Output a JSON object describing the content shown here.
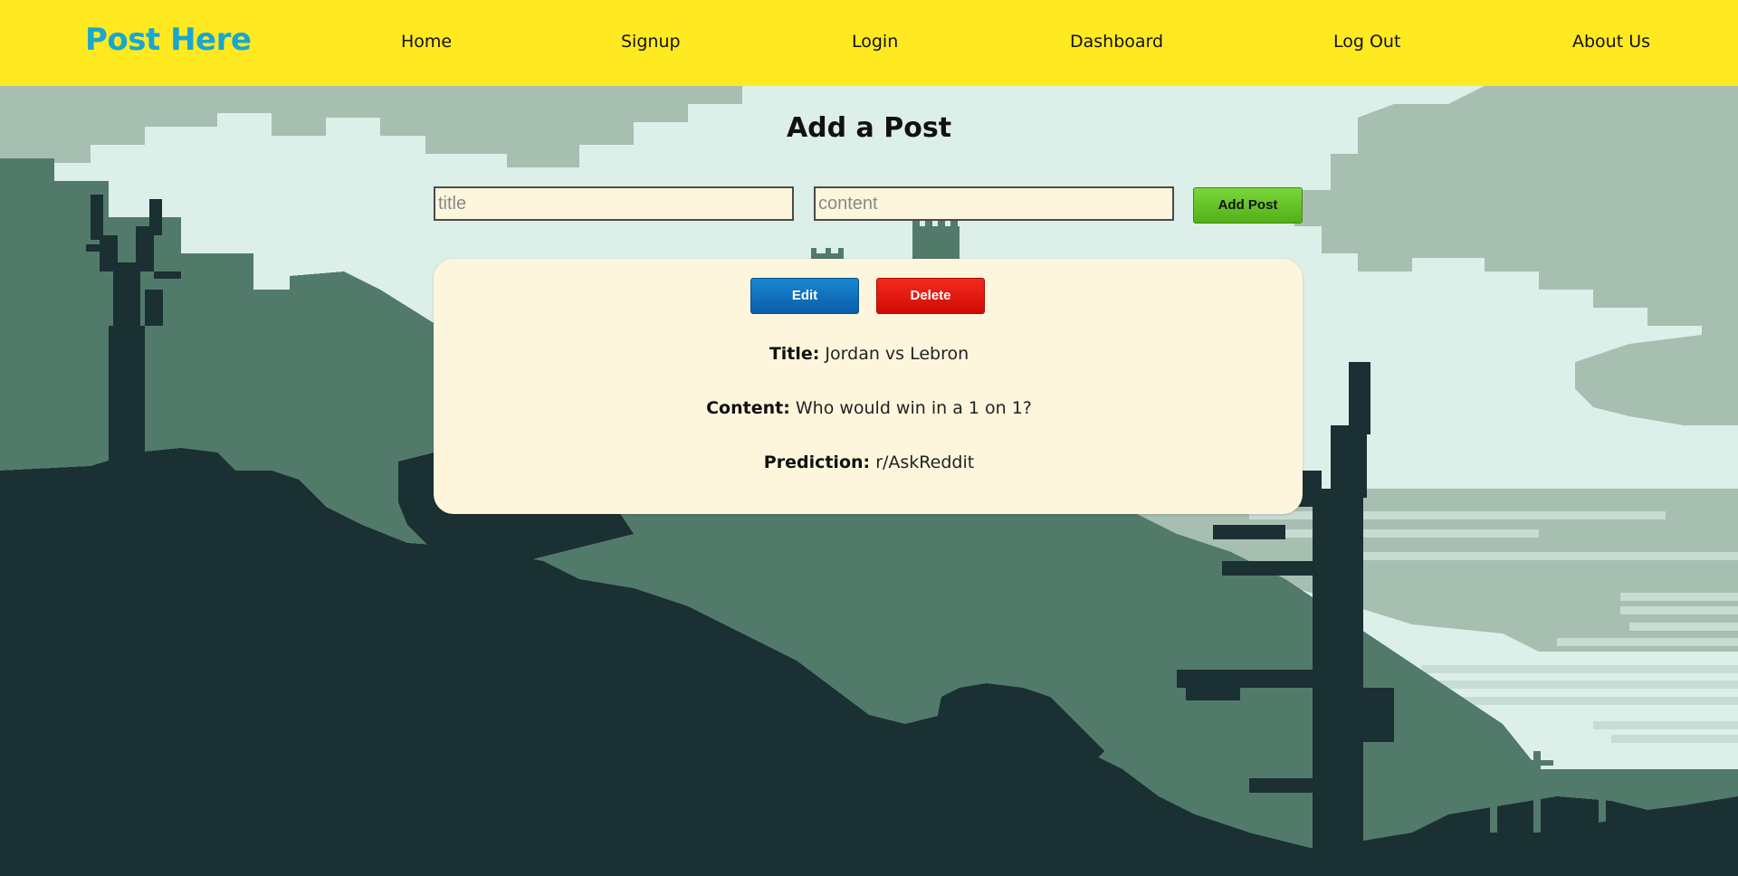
{
  "header": {
    "brand": "Post Here",
    "nav": [
      {
        "label": "Home"
      },
      {
        "label": "Signup"
      },
      {
        "label": "Login"
      },
      {
        "label": "Dashboard"
      },
      {
        "label": "Log Out"
      },
      {
        "label": "About Us"
      }
    ]
  },
  "main": {
    "title": "Add a Post",
    "title_input": {
      "placeholder": "title",
      "value": ""
    },
    "content_input": {
      "placeholder": "content",
      "value": ""
    },
    "add_button": "Add Post"
  },
  "post": {
    "edit_button": "Edit",
    "delete_button": "Delete",
    "title_label": "Title:",
    "title_value": "Jordan vs Lebron",
    "content_label": "Content:",
    "content_value": "Who would win in a 1 on 1?",
    "prediction_label": "Prediction:",
    "prediction_value": "r/AskReddit"
  },
  "colors": {
    "header_bg": "#ffe921",
    "brand": "#19a6d0",
    "card_bg": "#fdf6dc",
    "add_button": "#5cbf1e",
    "edit_button": "#0f6fbd",
    "delete_button": "#e41a10"
  }
}
